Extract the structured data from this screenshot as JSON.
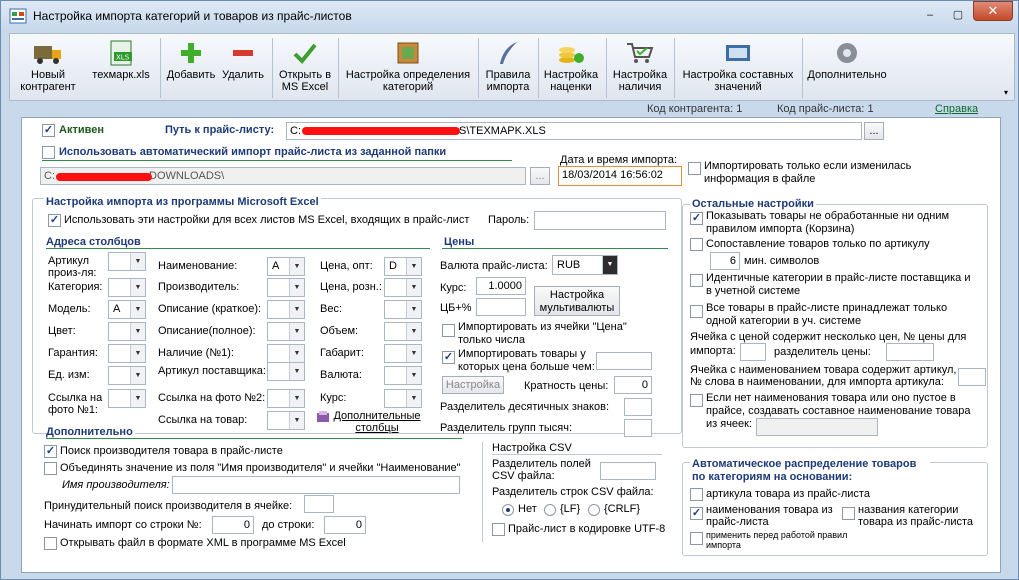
{
  "window": {
    "title": "Настройка импорта категорий и товаров из прайс-листов",
    "min": "–",
    "max": "▢",
    "close": "✕"
  },
  "toolbar": {
    "new_contractor": "Новый контрагент",
    "file_name": "техмарк.xls",
    "add": "Добавить",
    "delete": "Удалить",
    "open_excel": "Открыть в MS Excel",
    "category_settings": "Настройка определения категорий",
    "import_rules": "Правила импорта",
    "markup_settings": "Настройка наценки",
    "availability_settings": "Настройка наличия",
    "composite_values": "Настройка составных значений",
    "more": "Дополнительно",
    "xls_badge": "XLS"
  },
  "status": {
    "contractor_code": "Код контрагента: 1",
    "pricelist_code": "Код прайс-листа: 1",
    "help": "Справка"
  },
  "top": {
    "active_label": "Активен",
    "path_label": "Путь к прайс-листу:",
    "path_prefix": "C:",
    "path_suffix": "S\\TEXMAPK.XLS",
    "browse": "...",
    "auto_import_label": "Использовать автоматический импорт прайс-листа из заданной папки",
    "folder_prefix": "C:",
    "folder_suffix": "DOWNLOADS\\",
    "datetime_label": "Дата и время импорта:",
    "datetime_value": "18/03/2014 16:56:02",
    "only_changed_label": "Импортировать только если изменилась информация в файле"
  },
  "excel": {
    "section_title": "Настройка импорта из программы Microsoft Excel",
    "use_all_sheets": "Использовать эти настройки для всех листов MS Excel, входящих в прайс-лист",
    "password_label": "Пароль:",
    "columns_title": "Адреса столбцов",
    "col1": [
      {
        "label": "Артикул произ-ля:",
        "value": ""
      },
      {
        "label": "Категория:",
        "value": ""
      },
      {
        "label": "Модель:",
        "value": "A"
      },
      {
        "label": "Цвет:",
        "value": ""
      },
      {
        "label": "Гарантия:",
        "value": ""
      },
      {
        "label": "Ед. изм:",
        "value": ""
      },
      {
        "label": "Ссылка на фото №1:",
        "value": ""
      }
    ],
    "col2": [
      {
        "label": "Наименование:",
        "value": "A"
      },
      {
        "label": "Производитель:",
        "value": ""
      },
      {
        "label": "Описание (краткое):",
        "value": ""
      },
      {
        "label": "Описание(полное):",
        "value": ""
      },
      {
        "label": "Наличие (№1):",
        "value": ""
      },
      {
        "label": "Артикул поставщика:",
        "value": ""
      },
      {
        "label": "Ссылка на фото №2:",
        "value": ""
      },
      {
        "label": "Ссылка на товар:",
        "value": ""
      }
    ],
    "col3": [
      {
        "label": "Цена, опт:",
        "value": "D"
      },
      {
        "label": "Цена, розн.:",
        "value": ""
      },
      {
        "label": "Вес:",
        "value": ""
      },
      {
        "label": "Объем:",
        "value": ""
      },
      {
        "label": "Габарит:",
        "value": ""
      },
      {
        "label": "Валюта:",
        "value": ""
      },
      {
        "label": "Курс:",
        "value": ""
      }
    ],
    "extra_columns": "Дополнительные столбцы",
    "prices_title": "Цены",
    "currency_label": "Валюта прайс-листа:",
    "currency_value": "RUB",
    "rate_label": "Курс:",
    "rate_value": "1.0000",
    "cb_label": "ЦБ+%",
    "multicurrency": "Настройка мультивалюты",
    "import_from_price_cell": "Импортировать из ячейки \"Цена\" только числа",
    "import_price_greater": "Импортировать товары у которых цена больше чем:",
    "settings_btn": "Настройка",
    "price_multiplicity_label": "Кратность цены:",
    "price_multiplicity_value": "0",
    "decimal_sep_label": "Разделитель десятичных знаков:",
    "thousand_sep_label": "Разделитель групп тысяч:"
  },
  "additional": {
    "title": "Дополнительно",
    "search_manufacturer": "Поиск производителя товара в прайс-листе",
    "combine_manufacturer": "Объединять значение из поля \"Имя производителя\" и ячейки \"Наименование\"",
    "manufacturer_name_label": "Имя производителя:",
    "forced_search_label": "Принудительный поиск производителя в ячейке:",
    "start_row_label": "Начинать импорт со строки №:",
    "start_row_value": "0",
    "to_row_label": "до строки:",
    "to_row_value": "0",
    "open_xml": "Открывать файл в формате XML в программе MS Excel"
  },
  "csv": {
    "title": "Настройка CSV",
    "field_sep_label": "Разделитель полей CSV файла:",
    "row_sep_label": "Разделитель строк CSV файла:",
    "opt_none": "Нет",
    "opt_lf": "{LF}",
    "opt_crlf": "{CRLF}",
    "utf8": "Прайс-лист в кодировке UTF-8"
  },
  "other": {
    "title": "Остальные настройки",
    "show_unprocessed": "Показывать товары не обработанные ни одним правилом импорта (Корзина)",
    "match_by_article": "Сопоставление товаров только по артикулу",
    "min_chars_value": "6",
    "min_chars_label": "мин. символов",
    "identical_categories": "Идентичные категории в прайс-листе поставщика и в учетной системе",
    "all_goods_one_category": "Все товары в прайс-листе принадлежат только одной категории в уч. системе",
    "multi_price_label": "Ячейка с ценой содержит несколько цен, № цены для импорта:",
    "price_sep_label": "разделитель цены:",
    "article_word_label": "Ячейка с наименованием товара содержит артикул, № слова в наименовании, для импорта артикула:",
    "composite_name_label": "Если нет наименования товара или оно пустое в прайсе, создавать составное наименование товара из ячеек:"
  },
  "autodist": {
    "title": "Автоматическое распределение товаров по категориям на основании:",
    "by_article": "артикула товара из прайс-листа",
    "by_name": "наименования товара из прайс-листа",
    "by_category_names": "названия категории товара из прайс-листа",
    "apply_before": "применить перед работой правил импорта"
  }
}
